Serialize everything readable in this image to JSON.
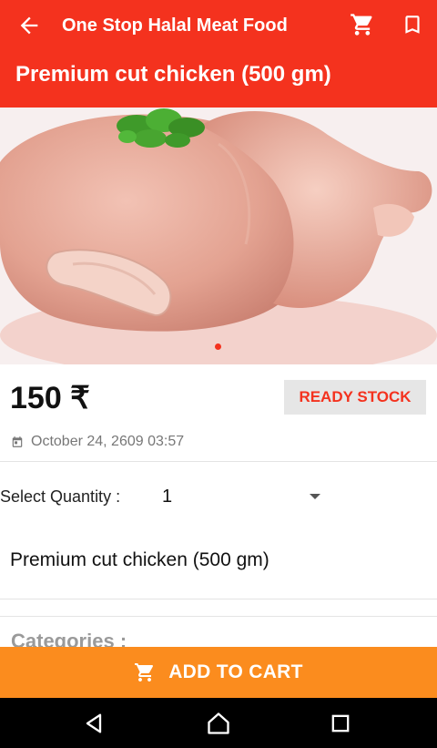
{
  "app_bar": {
    "title": "One Stop Halal Meat Food",
    "subtitle": "Premium cut chicken (500 gm)",
    "back_icon": "arrow-left-icon",
    "cart_icon": "shopping-cart-icon",
    "bookmark_icon": "bookmark-icon",
    "color": "#f4321e"
  },
  "product": {
    "image": "raw-chicken-photo",
    "carousel_pages": 1,
    "carousel_active": 1,
    "price": "150 ₹",
    "stock_badge": "READY STOCK",
    "date": "October 24, 2609 03:57",
    "quantity_label": "Select Quantity :",
    "quantity_value": "1",
    "description": "Premium cut chicken (500 gm)",
    "categories_label": "Categories :"
  },
  "cta": {
    "label": "ADD TO CART",
    "icon": "shopping-cart-icon",
    "color": "#fb8c1e"
  },
  "system_nav": {
    "back_icon": "nav-back-icon",
    "home_icon": "nav-home-icon",
    "recents_icon": "nav-recents-icon"
  }
}
